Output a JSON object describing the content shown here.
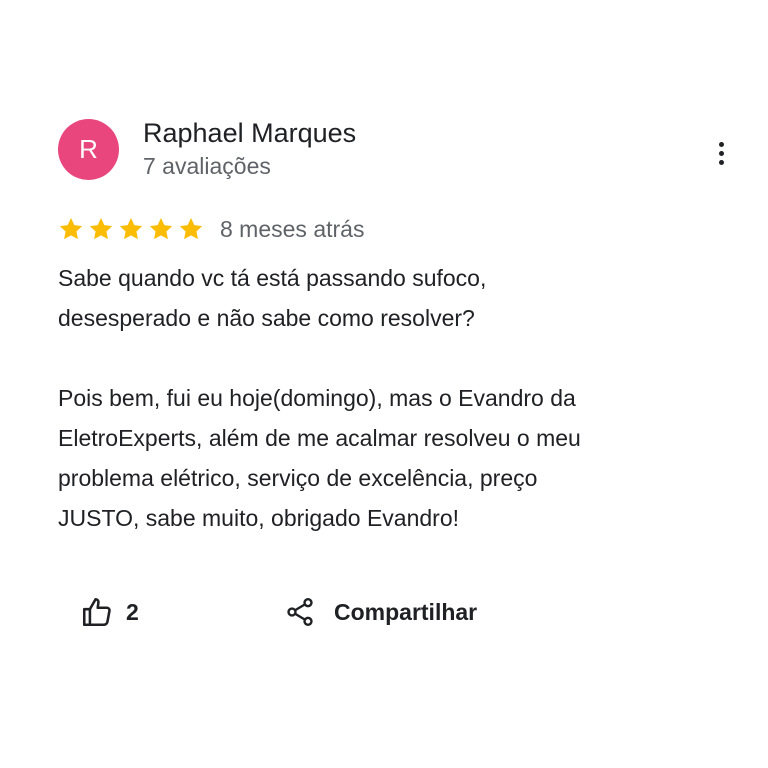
{
  "review": {
    "author": {
      "initial": "R",
      "name": "Raphael Marques",
      "reviews_count": "7 avaliações",
      "avatar_color": "#e8467c"
    },
    "rating": 5,
    "max_rating": 5,
    "star_color": "#fbbc04",
    "time_ago": "8 meses atrás",
    "paragraphs": [
      "Sabe quando vc tá está passando sufoco,\ndesesperado e não sabe como resolver?",
      "Pois bem, fui eu hoje(domingo), mas o Evandro da\nEletroExperts, além de me acalmar resolveu o meu\nproblema elétrico, serviço de excelência, preço\nJUSTO, sabe muito, obrigado Evandro!"
    ]
  },
  "actions": {
    "like_icon": "thumbs-up-icon",
    "like_count": "2",
    "share_icon": "share-icon",
    "share_label": "Compartilhar",
    "more_icon": "more-vert-icon"
  }
}
